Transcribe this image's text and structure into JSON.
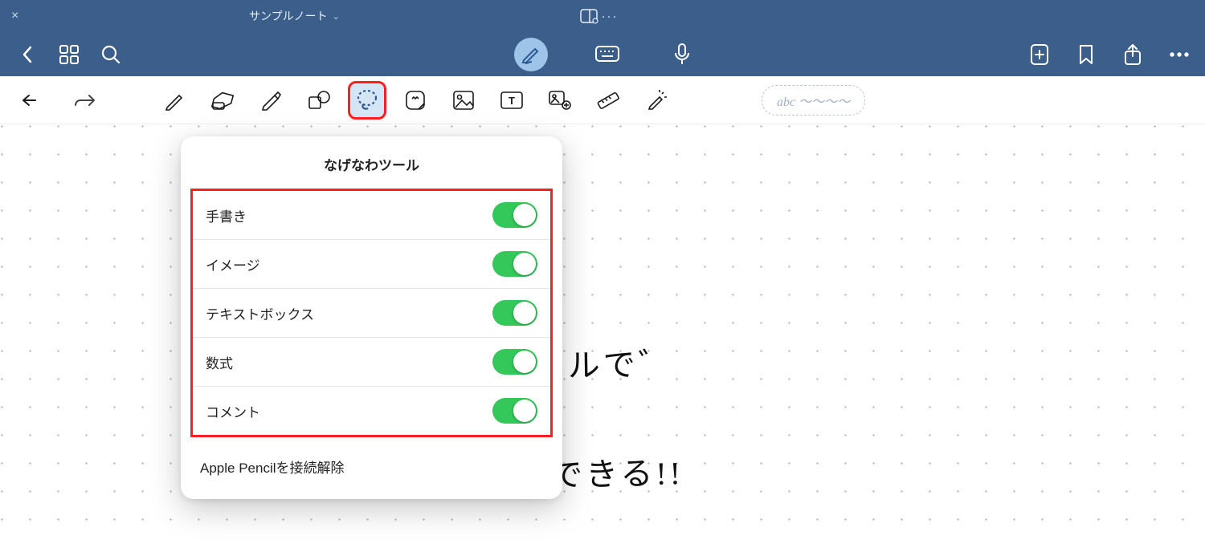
{
  "titlebar": {
    "title": "サンプルノート"
  },
  "popover": {
    "title": "なげなわツール",
    "toggles": [
      {
        "label": "手書き"
      },
      {
        "label": "イメージ"
      },
      {
        "label": "テキストボックス"
      },
      {
        "label": "数式"
      },
      {
        "label": "コメント"
      }
    ],
    "disconnect": "Apple Pencilを接続解除"
  },
  "abc_badge": "abc ～～～～",
  "handwriting": {
    "line1": "っツールで゛",
    "line2": "とができる!!"
  }
}
